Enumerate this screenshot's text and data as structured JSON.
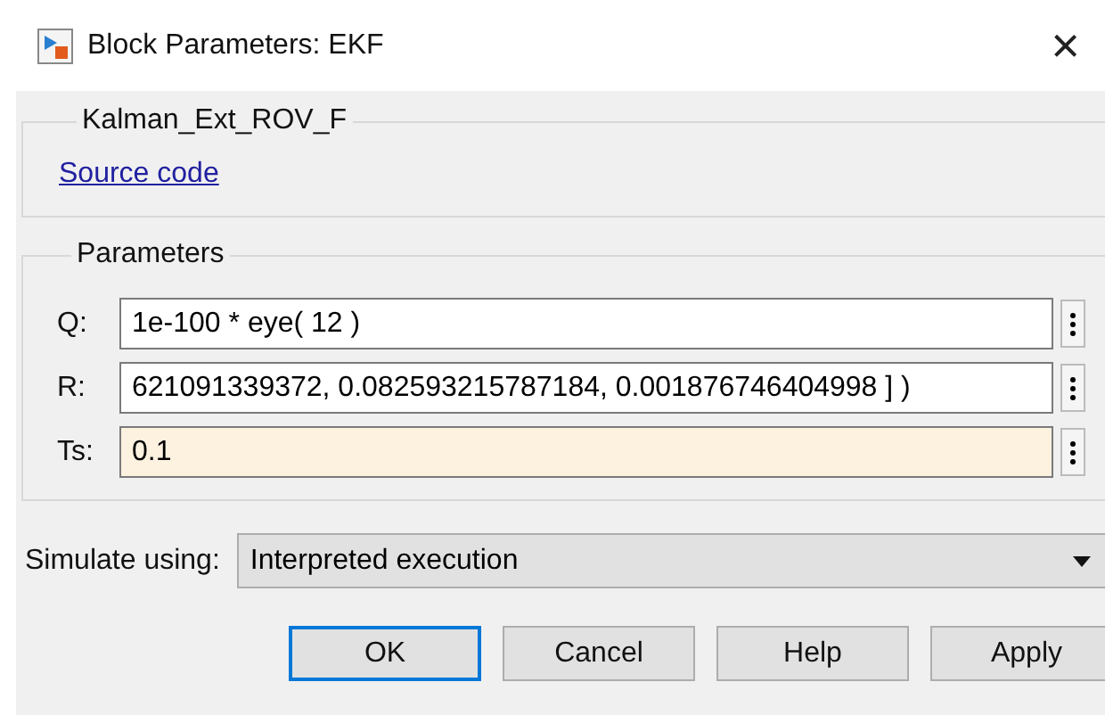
{
  "window": {
    "title": "Block Parameters: EKF",
    "close": "×"
  },
  "block_group": {
    "title": "Kalman_Ext_ROV_F",
    "link": "Source code"
  },
  "parameters": {
    "title": "Parameters",
    "fields": [
      {
        "label": "Q:",
        "value": "1e-100 * eye( 12 )",
        "highlighted": false
      },
      {
        "label": "R:",
        "value": "621091339372, 0.082593215787184, 0.001876746404998 ] )",
        "highlighted": false
      },
      {
        "label": "Ts:",
        "value": "0.1",
        "highlighted": true
      }
    ]
  },
  "simulate": {
    "label": "Simulate using:",
    "value": "Interpreted execution"
  },
  "buttons": [
    {
      "label": "OK",
      "default": true
    },
    {
      "label": "Cancel",
      "default": false
    },
    {
      "label": "Help",
      "default": false
    },
    {
      "label": "Apply",
      "default": false
    }
  ]
}
